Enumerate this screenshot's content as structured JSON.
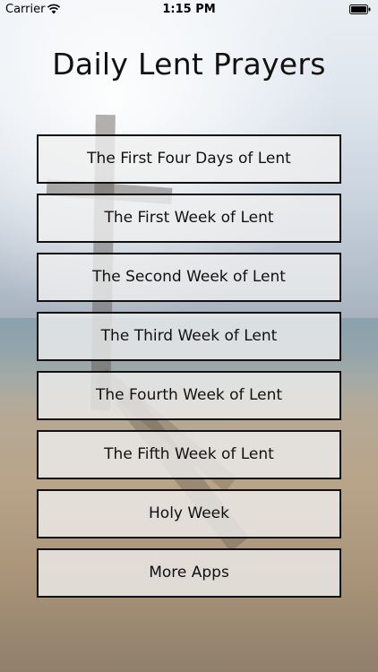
{
  "status_bar": {
    "carrier": "Carrier",
    "time": "1:15 PM"
  },
  "title": "Daily Lent Prayers",
  "menu": [
    {
      "label": "The First Four Days of Lent"
    },
    {
      "label": "The First Week of Lent"
    },
    {
      "label": "The Second Week of Lent"
    },
    {
      "label": "The Third Week of Lent"
    },
    {
      "label": "The Fourth Week of Lent"
    },
    {
      "label": "The Fifth Week of Lent"
    },
    {
      "label": "Holy Week"
    },
    {
      "label": "More Apps"
    }
  ]
}
